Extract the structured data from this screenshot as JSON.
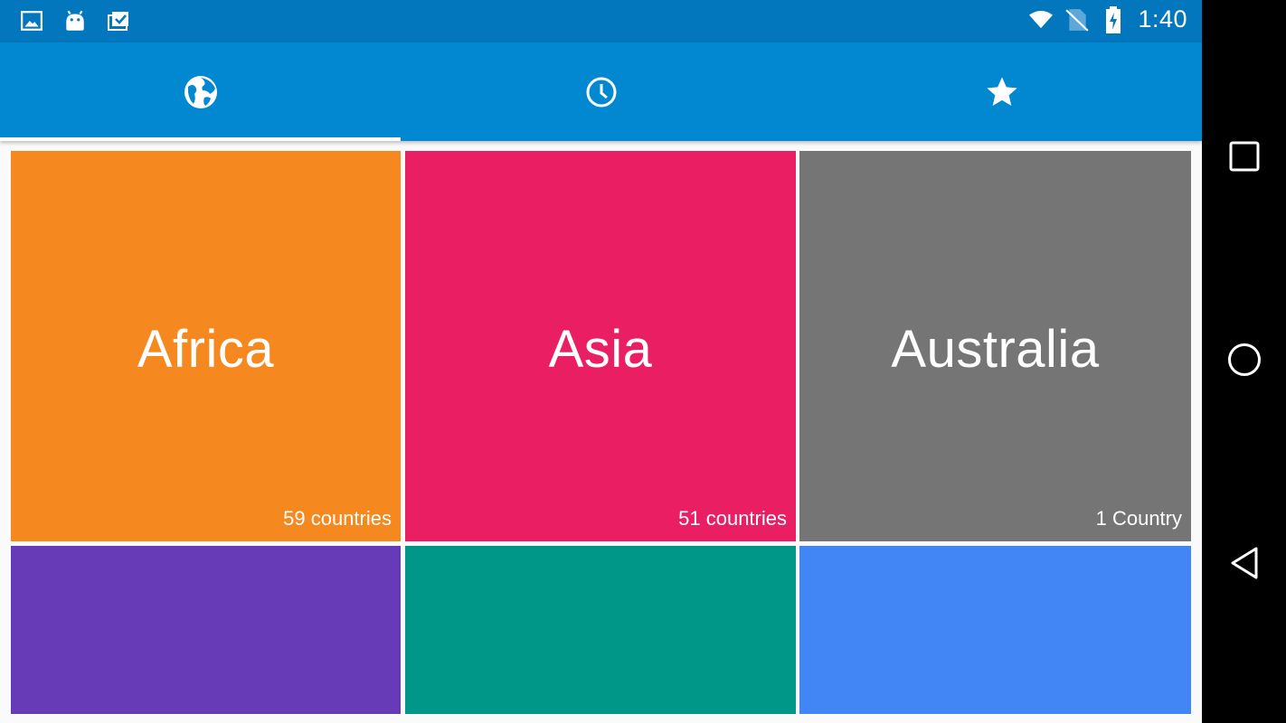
{
  "status_bar": {
    "time": "1:40",
    "left_icons": [
      "image-icon",
      "android-icon",
      "clipboard-check-icon"
    ],
    "right_icons": [
      "wifi-icon",
      "no-sim-icon",
      "battery-charging-icon"
    ]
  },
  "tabs": [
    {
      "icon": "globe-icon",
      "active": true
    },
    {
      "icon": "clock-icon",
      "active": false
    },
    {
      "icon": "star-icon",
      "active": false
    }
  ],
  "continents": [
    {
      "name": "Africa",
      "count": "59 countries",
      "color": "#f5881f"
    },
    {
      "name": "Asia",
      "count": "51 countries",
      "color": "#e91e63"
    },
    {
      "name": "Australia",
      "count": "1 Country",
      "color": "#757575"
    },
    {
      "name": "",
      "count": "",
      "color": "#673ab7"
    },
    {
      "name": "",
      "count": "",
      "color": "#009688"
    },
    {
      "name": "",
      "count": "",
      "color": "#4285f4"
    }
  ],
  "colors": {
    "status_bar": "#0277bd",
    "app_bar": "#0288d1",
    "background": "#fafafa"
  },
  "nav_bar": {
    "buttons": [
      "recents-square-icon",
      "home-circle-icon",
      "back-triangle-icon"
    ]
  }
}
